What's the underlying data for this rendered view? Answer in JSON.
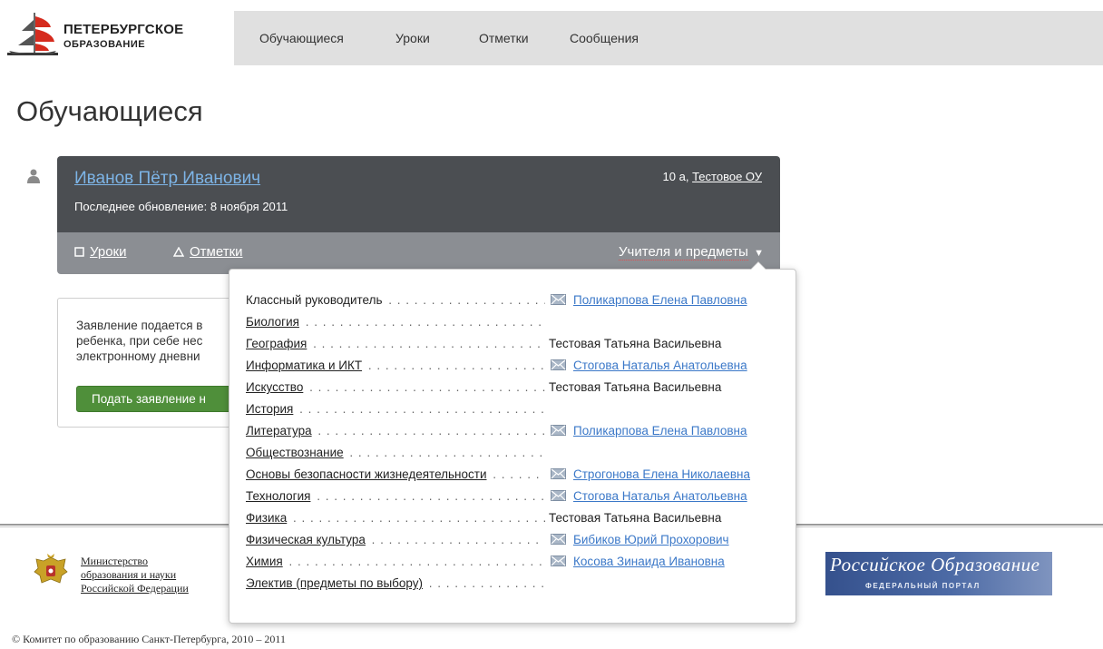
{
  "header": {
    "logo_line1": "ПЕТЕРБУРГСКОЕ",
    "logo_line2": "ОБРАЗОВАНИЕ",
    "nav": [
      "Обучающиеся",
      "Уроки",
      "Отметки",
      "Сообщения"
    ]
  },
  "page_title": "Обучающиеся",
  "student": {
    "name": "Иванов Пётр Иванович",
    "last_update": "Последнее обновление: 8 ноября 2011",
    "class": "10 а,",
    "school": "Тестовое ОУ",
    "tabs": {
      "lessons": "Уроки",
      "marks": "Отметки",
      "teachers": "Учителя и предметы"
    }
  },
  "application": {
    "text_lines": [
      "Заявление подается в",
      "ребенка, при себе нес",
      "электронному дневни"
    ],
    "button": "Подать заявление н"
  },
  "teachers_dropdown": [
    {
      "subject": "Классный руководитель",
      "link": false,
      "teacher": "Поликарпова Елена Павловна",
      "mail": true
    },
    {
      "subject": "Биология",
      "link": true,
      "teacher": "",
      "mail": false
    },
    {
      "subject": "География",
      "link": true,
      "teacher": "Тестовая Татьяна Васильевна",
      "mail": false
    },
    {
      "subject": "Информатика и ИКТ",
      "link": true,
      "teacher": "Стогова Наталья Анатольевна",
      "mail": true
    },
    {
      "subject": "Искусство",
      "link": true,
      "teacher": "Тестовая Татьяна Васильевна",
      "mail": false
    },
    {
      "subject": "История",
      "link": true,
      "teacher": "",
      "mail": false
    },
    {
      "subject": "Литература",
      "link": true,
      "teacher": "Поликарпова Елена Павловна",
      "mail": true
    },
    {
      "subject": "Обществознание",
      "link": true,
      "teacher": "",
      "mail": false
    },
    {
      "subject": "Основы безопасности жизнедеятельности",
      "link": true,
      "teacher": "Строгонова Елена Николаевна",
      "mail": true
    },
    {
      "subject": "Технология",
      "link": true,
      "teacher": "Стогова Наталья Анатольевна",
      "mail": true
    },
    {
      "subject": "Физика",
      "link": true,
      "teacher": "Тестовая Татьяна Васильевна",
      "mail": false
    },
    {
      "subject": "Физическая культура",
      "link": true,
      "teacher": "Бибиков Юрий Прохорович",
      "mail": true
    },
    {
      "subject": "Химия",
      "link": true,
      "teacher": "Косова Зинаида Ивановна",
      "mail": true
    },
    {
      "subject": "Электив (предметы по выбору)",
      "link": true,
      "teacher": "",
      "mail": false
    }
  ],
  "footer": {
    "ministry_lines": [
      "Министерство",
      "образования и науки",
      "Российской Федерации"
    ],
    "portal_title": "Российское Образование",
    "portal_subtitle": "ФЕДЕРАЛЬНЫЙ ПОРТАЛ",
    "copyright": "© Комитет по образованию Санкт-Петербурга, 2010 – 2011"
  },
  "colors": {
    "card_dark": "#4b4e52",
    "card_light": "#8b8e93",
    "link_blue": "#3b78c8",
    "button_green": "#4f8f3a",
    "nav_bg": "#e0e0e0"
  }
}
